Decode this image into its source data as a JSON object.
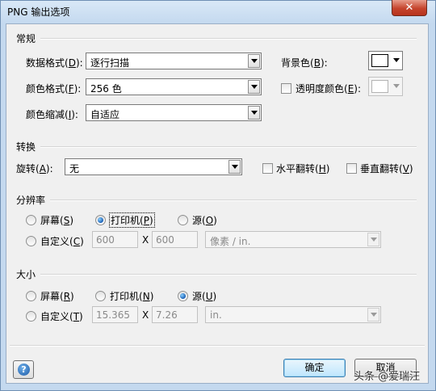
{
  "window": {
    "title": "PNG 输出选项",
    "close_label": "✕"
  },
  "general": {
    "section_title": "常规",
    "data_format": {
      "label": "数据格式",
      "key": "D",
      "value": "逐行扫描"
    },
    "color_format": {
      "label": "颜色格式",
      "key": "F",
      "value": "256 色"
    },
    "color_reduction": {
      "label": "颜色缩减",
      "key": "I",
      "value": "自适应"
    },
    "background_color": {
      "label": "背景色",
      "key": "B"
    },
    "transparency_color": {
      "label": "透明度颜色",
      "key": "E",
      "checked": false
    }
  },
  "transform": {
    "section_title": "转换",
    "rotation": {
      "label": "旋转",
      "key": "A",
      "value": "无"
    },
    "flip_horizontal": {
      "label": "水平翻转",
      "key": "H",
      "checked": false
    },
    "flip_vertical": {
      "label": "垂直翻转",
      "key": "V",
      "checked": false
    }
  },
  "resolution": {
    "section_title": "分辨率",
    "screen": {
      "label": "屏幕",
      "key": "S",
      "selected": false
    },
    "printer": {
      "label": "打印机",
      "key": "P",
      "selected": true
    },
    "source": {
      "label": "源",
      "key": "O",
      "selected": false
    },
    "custom": {
      "label": "自定义",
      "key": "C",
      "selected": false
    },
    "width": "600",
    "height": "600",
    "separator": "X",
    "unit": "像素 / in."
  },
  "size": {
    "section_title": "大小",
    "screen": {
      "label": "屏幕",
      "key": "R",
      "selected": false
    },
    "printer": {
      "label": "打印机",
      "key": "N",
      "selected": false
    },
    "source": {
      "label": "源",
      "key": "U",
      "selected": true
    },
    "custom": {
      "label": "自定义",
      "key": "T",
      "selected": false
    },
    "width": "15.365",
    "height": "7.26",
    "separator": "X",
    "unit": "in."
  },
  "footer": {
    "help_label": "?",
    "ok_label": "确定",
    "cancel_label": "取消",
    "watermark": "头条 @爱瑞汪"
  },
  "icons": {
    "close": "close-icon",
    "help": "help-icon",
    "dropdown": "chevron-down-icon"
  },
  "colors": {
    "title_bar": "#c4d9ef",
    "close_button": "#c5442d",
    "dialog_background": "#f0f0f0",
    "radio_selected": "#1a5fb4",
    "default_button": "#bee6fd"
  }
}
